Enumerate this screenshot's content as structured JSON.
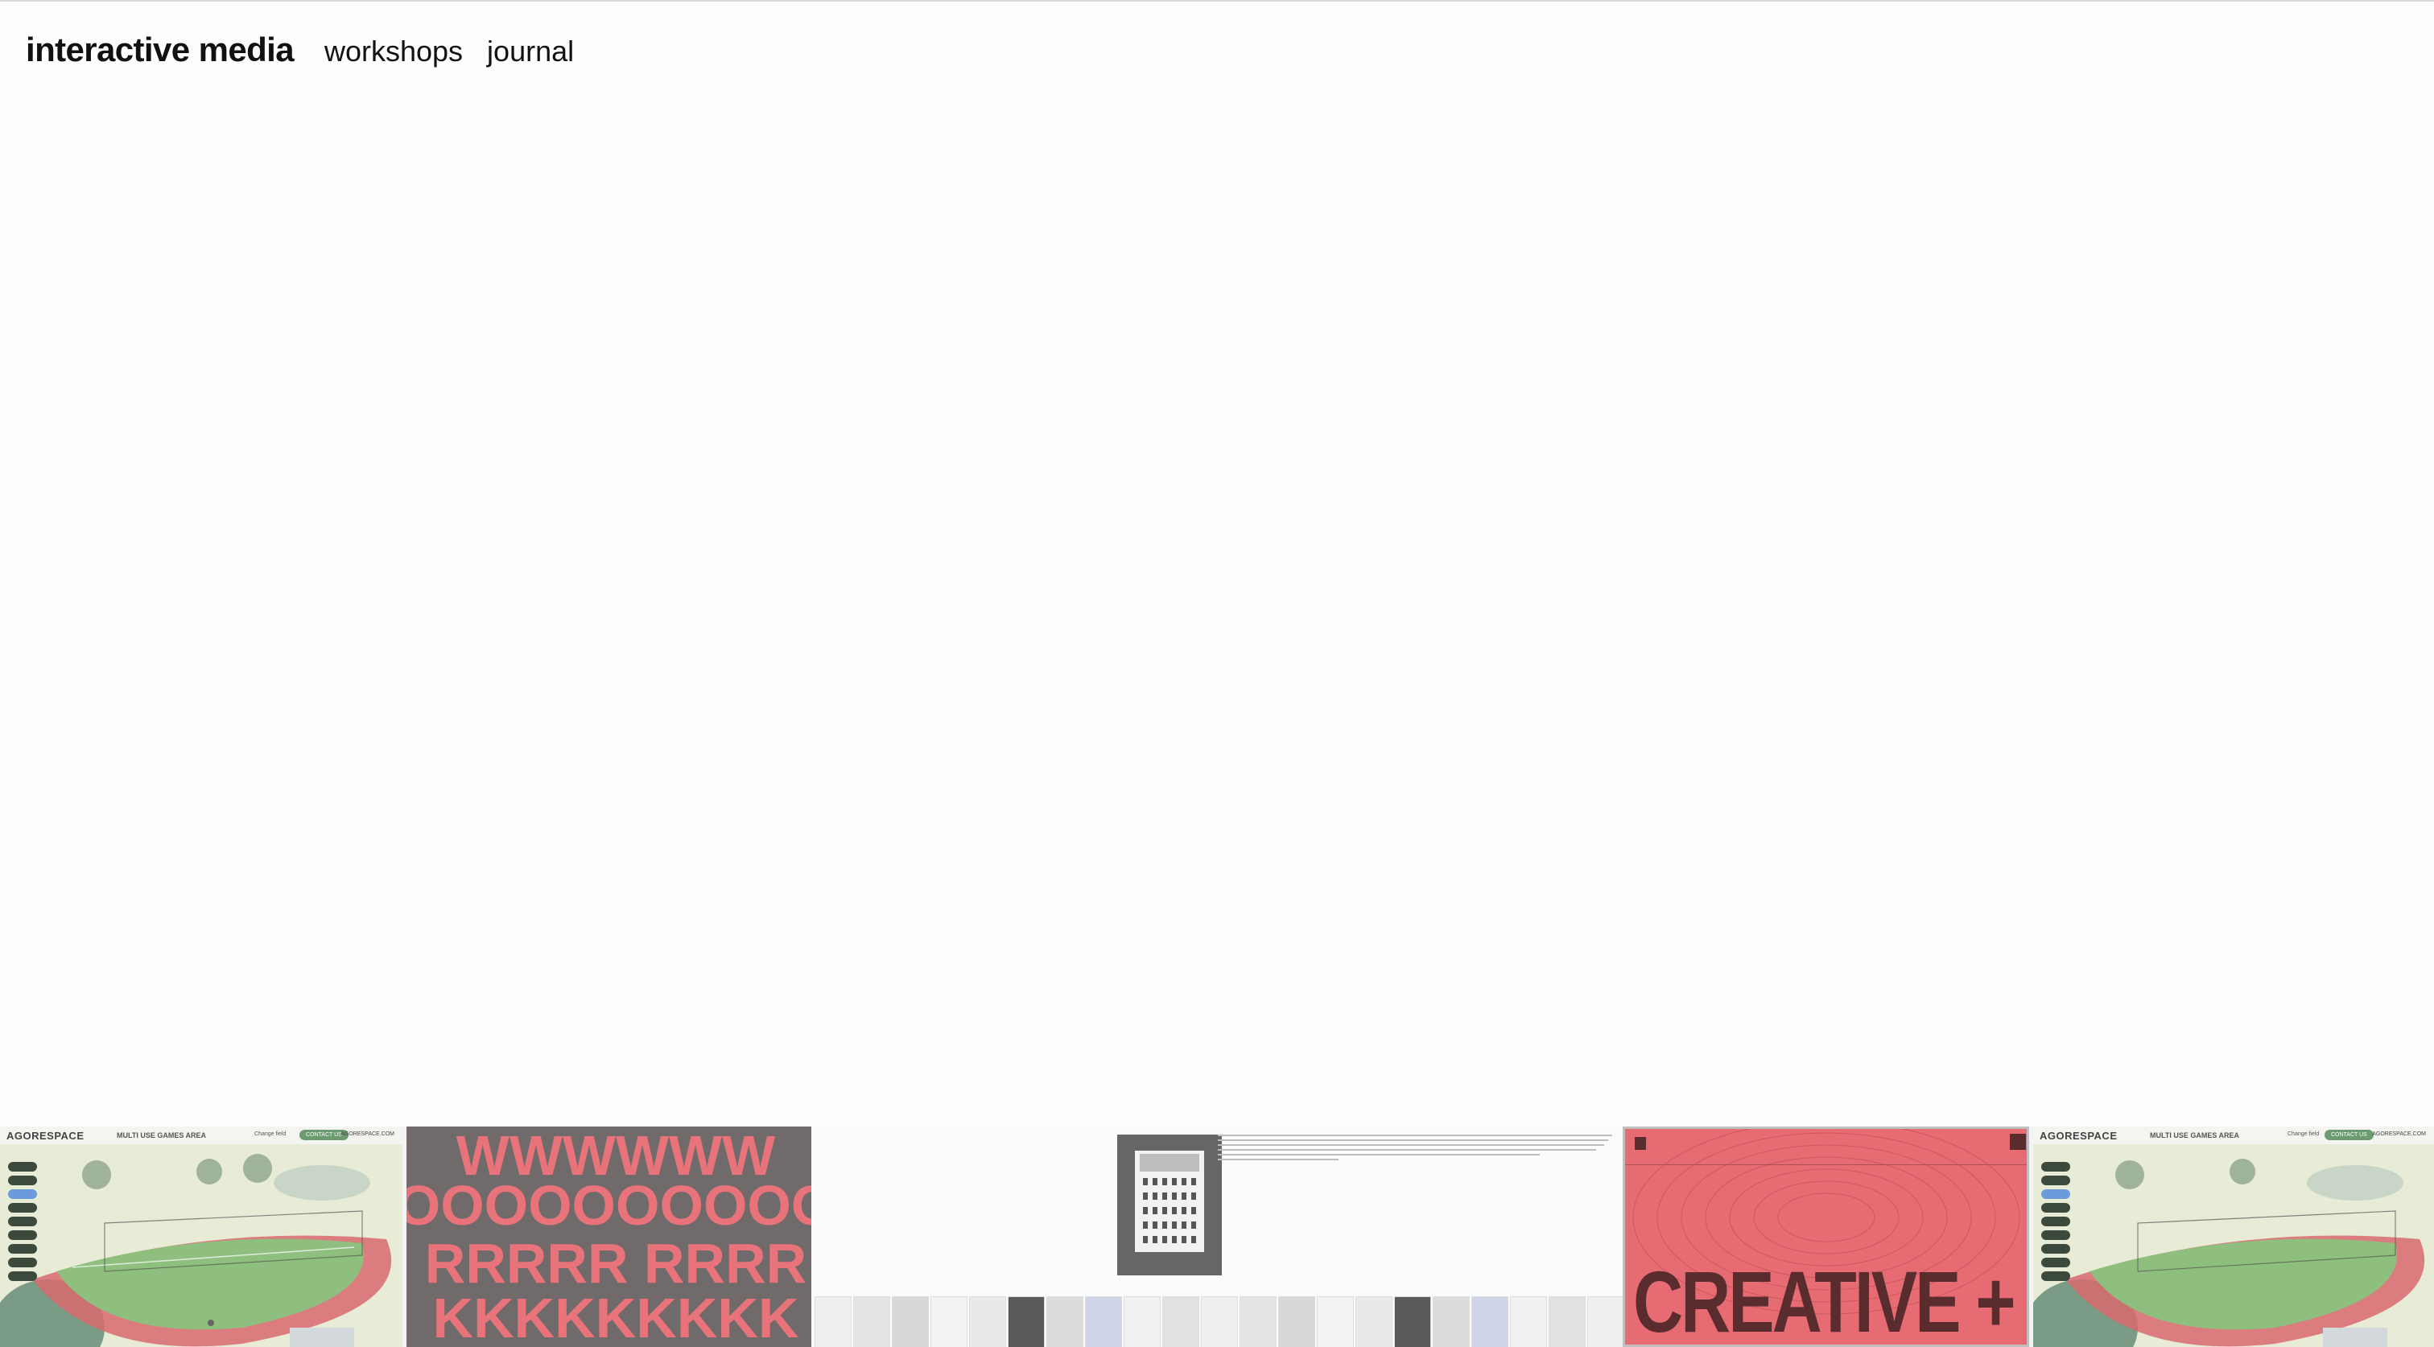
{
  "nav": {
    "brand": "interactive media",
    "links": [
      "workshops",
      "journal"
    ]
  },
  "strip": {
    "agora": {
      "logo": "AGORESPACE",
      "subtitle": "MULTI USE GAMES AREA",
      "change": "Change field",
      "contact": "CONTACT US",
      "site": "AGORESPACE.COM"
    },
    "work": {
      "rows": [
        "WWWWWW",
        "OOOOOOOOOO",
        "RRRRR RRRR",
        "KKKKKKKKK"
      ]
    },
    "creative": {
      "title": "CREATIVE + DEVELOPER"
    }
  },
  "colors": {
    "accent_pink": "#e66b73",
    "tile_gray": "#706a6a",
    "agora_green": "#6c9b6f"
  }
}
